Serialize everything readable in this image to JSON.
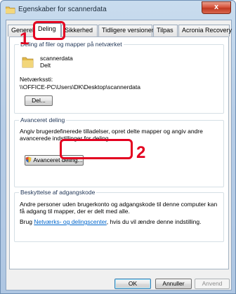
{
  "window": {
    "title": "Egenskaber for scannerdata",
    "close_label": "x"
  },
  "tabs": [
    {
      "label": "Generelt"
    },
    {
      "label": "Deling"
    },
    {
      "label": "Sikkerhed"
    },
    {
      "label": "Tidligere versioner"
    },
    {
      "label": "Tilpas"
    },
    {
      "label": "Acronia Recovery"
    }
  ],
  "network_sharing": {
    "group_label": "Deling af filer og mapper på netværket",
    "folder_name": "scannerdata",
    "folder_state": "Delt",
    "path_label": "Netværkssti:",
    "path_value": "\\\\OFFICE-PC\\Users\\DK\\Desktop\\scannerdata",
    "share_button": "Del..."
  },
  "advanced_sharing": {
    "group_label": "Avanceret deling",
    "description": "Angiv brugerdefinerede tilladelser, opret delte mapper og angiv andre avancerede indstillinger for deling.",
    "button_label": "Avanceret deling..."
  },
  "password_protection": {
    "group_label": "Beskyttelse af adgangskode",
    "description": "Andre personer uden brugerkonto og adgangskode til denne computer kan få adgang til mapper, der er delt med alle.",
    "link_prefix": "Brug ",
    "link_text": "Netværks- og delingscenter",
    "link_suffix": ", hvis du vil ændre denne indstilling."
  },
  "footer": {
    "ok": "OK",
    "cancel": "Annuller",
    "apply": "Anvend"
  },
  "annotations": {
    "step1": "1",
    "step2": "2",
    "color": "#e3001f"
  }
}
